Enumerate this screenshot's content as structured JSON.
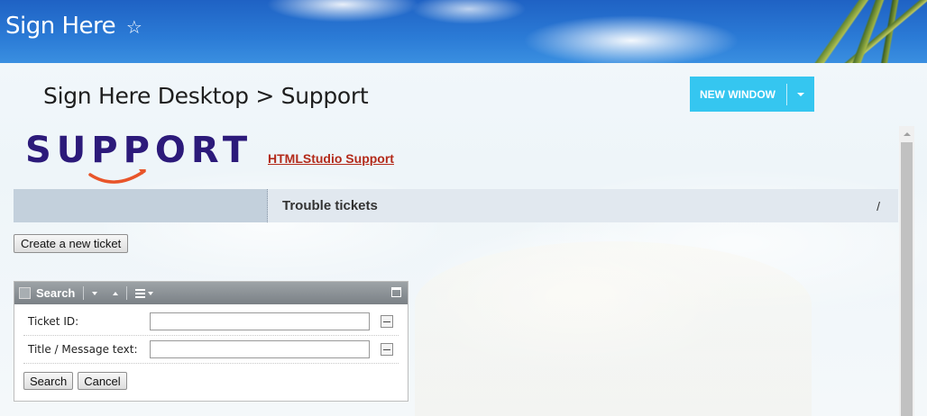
{
  "header": {
    "app_title": "Sign Here",
    "favorite_glyph": "☆"
  },
  "page": {
    "breadcrumb": "Sign Here Desktop > Support"
  },
  "toolbar": {
    "new_window_label": "NEW WINDOW"
  },
  "logo": {
    "text": "SUPPORT"
  },
  "links": {
    "support_link": "HTMLStudio Support"
  },
  "section": {
    "title": "Trouble tickets",
    "slash": "/"
  },
  "buttons": {
    "create_ticket": "Create a new ticket"
  },
  "search_panel": {
    "title": "Search",
    "fields": [
      {
        "label": "Ticket ID:",
        "value": ""
      },
      {
        "label": "Title / Message text:",
        "value": ""
      }
    ],
    "search_button": "Search",
    "cancel_button": "Cancel"
  },
  "colors": {
    "accent": "#35c6f0",
    "link": "#b32a1a",
    "logo": "#2c1a7a",
    "logo_swoosh": "#e8552a"
  }
}
